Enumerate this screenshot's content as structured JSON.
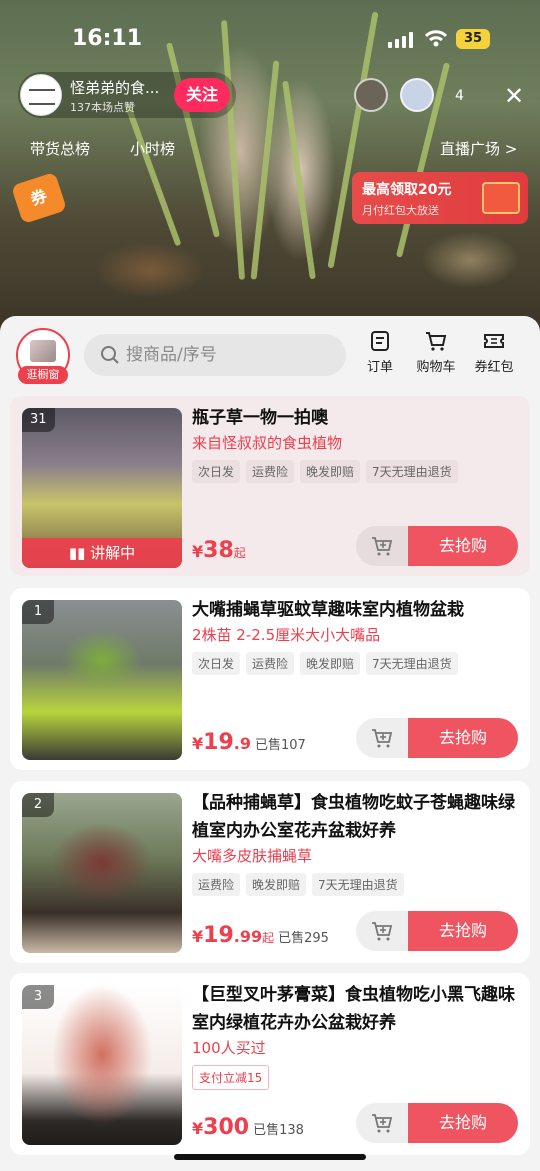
{
  "status": {
    "time": "16:11",
    "battery": "35"
  },
  "anchor": {
    "name": "怪弟弟的食...",
    "sub": "137本场点赞",
    "follow": "关注",
    "viewer_count": "4"
  },
  "nav": {
    "rank_total": "带货总榜",
    "rank_hour": "小时榜",
    "plaza": "直播广场 >"
  },
  "coupon": {
    "tag": "券"
  },
  "redpacket": {
    "title": "最高领取20元",
    "sub": "月付红包大放送"
  },
  "shop": {
    "tag": "逛橱窗"
  },
  "search": {
    "placeholder": "搜商品/序号"
  },
  "tools": [
    {
      "label": "订单",
      "icon": "order-icon"
    },
    {
      "label": "购物车",
      "icon": "cart-icon"
    },
    {
      "label": "券红包",
      "icon": "coupon-icon"
    }
  ],
  "products": [
    {
      "num": "31",
      "live": "讲解中",
      "title": "瓶子草一物一拍噢",
      "sub": "来自怪叔叔的食虫植物",
      "tags": [
        "次日发",
        "运费险",
        "晚发即赔",
        "7天无理由退货"
      ],
      "price_cur": "¥",
      "price_int": "38",
      "price_dec": "",
      "price_suffix": "起",
      "sold": "",
      "buy": "去抢购"
    },
    {
      "num": "1",
      "title": "大嘴捕蝇草驱蚊草趣味室内植物盆栽",
      "sub": "2株苗 2-2.5厘米大小大嘴品",
      "tags": [
        "次日发",
        "运费险",
        "晚发即赔",
        "7天无理由退货"
      ],
      "price_cur": "¥",
      "price_int": "19",
      "price_dec": ".9",
      "price_suffix": "",
      "sold": "已售107",
      "buy": "去抢购"
    },
    {
      "num": "2",
      "title": "【品种捕蝇草】食虫植物吃蚊子苍蝇趣味绿植室内办公室花卉盆栽好养",
      "sub": "大嘴多皮肤捕蝇草",
      "tags": [
        "运费险",
        "晚发即赔",
        "7天无理由退货"
      ],
      "price_cur": "¥",
      "price_int": "19",
      "price_dec": ".99",
      "price_suffix": "起",
      "sold": "已售295",
      "buy": "去抢购"
    },
    {
      "num": "3",
      "title": "【巨型叉叶茅膏菜】食虫植物吃小黑飞趣味室内绿植花卉办公盆栽好养",
      "sub": "100人买过",
      "tags": [
        "支付立减15"
      ],
      "price_cur": "¥",
      "price_int": "300",
      "price_dec": "",
      "price_suffix": "",
      "sold": "已售138",
      "buy": "去抢购"
    }
  ]
}
